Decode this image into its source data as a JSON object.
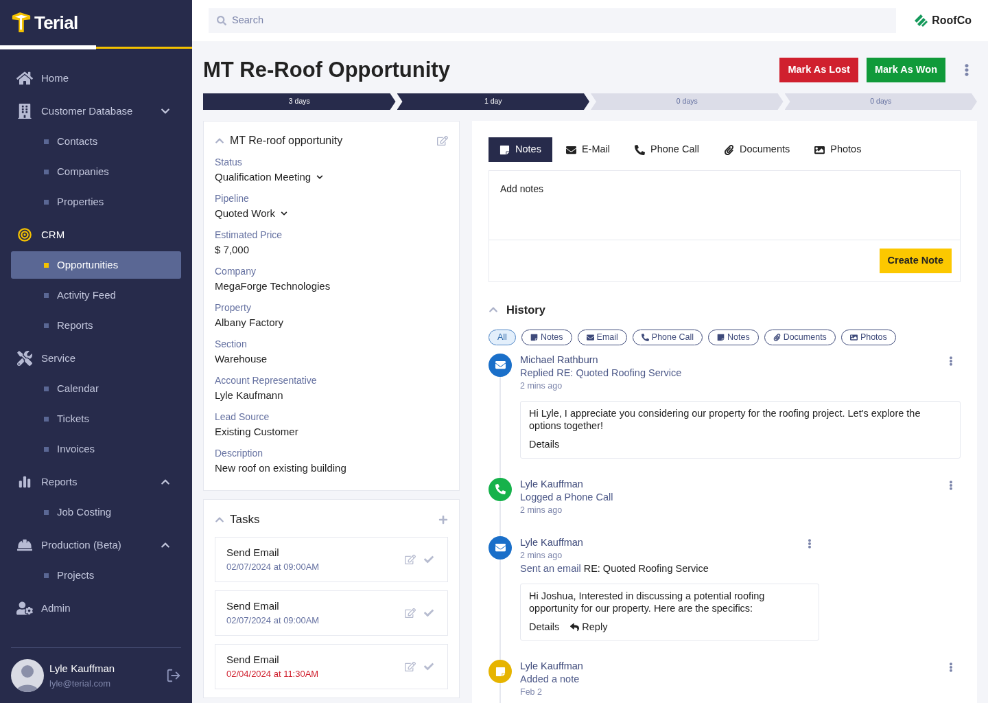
{
  "sidebar": {
    "brand": "Terial",
    "sections": [
      {
        "label": "Home",
        "selected": false
      },
      {
        "label": "Customer Database",
        "selected": false,
        "expanded": false,
        "children": [
          {
            "label": "Contacts",
            "selected": false
          },
          {
            "label": "Companies",
            "selected": false
          },
          {
            "label": "Properties",
            "selected": false
          }
        ]
      },
      {
        "label": "CRM",
        "selected": true,
        "children": [
          {
            "label": "Opportunities",
            "selected": true
          },
          {
            "label": "Activity Feed",
            "selected": false
          },
          {
            "label": "Reports",
            "selected": false
          }
        ]
      },
      {
        "label": "Service",
        "selected": false,
        "children": [
          {
            "label": "Calendar",
            "selected": false
          },
          {
            "label": "Tickets",
            "selected": false
          },
          {
            "label": "Invoices",
            "selected": false
          }
        ]
      },
      {
        "label": "Reports",
        "selected": false,
        "expanded": true,
        "children": [
          {
            "label": "Job Costing",
            "selected": false
          }
        ]
      },
      {
        "label": "Production (Beta)",
        "selected": false,
        "expanded": true,
        "children": [
          {
            "label": "Projects",
            "selected": false
          }
        ]
      },
      {
        "label": "Admin",
        "selected": false
      }
    ],
    "user": {
      "name": "Lyle Kauffman",
      "email": "lyle@terial.com"
    }
  },
  "search": {
    "placeholder": "Search"
  },
  "company": "RoofCo",
  "title": "MT Re-Roof Opportunity",
  "actions": [
    {
      "label": "Mark As Lost",
      "color": "#d0202e"
    },
    {
      "label": "Mark As Won",
      "color": "#109a3a"
    }
  ],
  "stages": [
    {
      "label": "3 days",
      "done": true
    },
    {
      "label": "1 day",
      "done": true
    },
    {
      "label": "0 days",
      "done": false
    },
    {
      "label": "0 days",
      "done": false
    }
  ],
  "details": {
    "title": "MT Re-roof opportunity",
    "fields": [
      {
        "label": "Status",
        "value": "Qualification Meeting",
        "kind": "dropdown"
      },
      {
        "label": "Pipeline",
        "value": "Quoted Work",
        "kind": "dropdown"
      },
      {
        "label": "Estimated Price",
        "value": "$ 7,000",
        "kind": "text"
      },
      {
        "label": "Company",
        "value": "MegaForge Technologies",
        "kind": "text"
      },
      {
        "label": "Property",
        "value": "Albany Factory",
        "kind": "text"
      },
      {
        "label": "Section",
        "value": "Warehouse",
        "kind": "text"
      },
      {
        "label": "Account Representative",
        "value": "Lyle Kaufmann",
        "kind": "text"
      },
      {
        "label": "Lead Source",
        "value": "Existing Customer",
        "kind": "text"
      },
      {
        "label": "Description",
        "value": "New roof on existing building",
        "kind": "text"
      }
    ]
  },
  "tasks": {
    "title": "Tasks",
    "items": [
      {
        "title": "Send Email",
        "due": "02/07/2024 at 09:00AM",
        "overdue": false
      },
      {
        "title": "Send Email",
        "due": "02/07/2024 at 09:00AM",
        "overdue": false
      },
      {
        "title": "Send Email",
        "due": "02/04/2024 at 11:30AM",
        "overdue": true
      }
    ]
  },
  "tabs": [
    {
      "label": "Notes",
      "selected": true
    },
    {
      "label": "E-Mail",
      "selected": false
    },
    {
      "label": "Phone Call",
      "selected": false
    },
    {
      "label": "Documents",
      "selected": false
    },
    {
      "label": "Photos",
      "selected": false
    }
  ],
  "notes": {
    "placeholder": "Add notes",
    "button": "Create Note"
  },
  "history": {
    "title": "History",
    "filters": [
      {
        "label": "All",
        "selected": true
      },
      {
        "label": "Notes",
        "selected": false
      },
      {
        "label": "Email",
        "selected": false
      },
      {
        "label": "Phone Call",
        "selected": false
      },
      {
        "label": "Notes",
        "selected": false
      },
      {
        "label": "Documents",
        "selected": false
      },
      {
        "label": "Photos",
        "selected": false
      }
    ],
    "entries": [
      {
        "kind": "email",
        "color": "#1a6fc9",
        "name": "Michael Rathburn",
        "action": "Replied RE: Quoted Roofing Service",
        "time": "2 mins ago",
        "body": "Hi Lyle, I appreciate you considering our property for the roofing project. Let's explore the options together!",
        "links": [
          "Details"
        ]
      },
      {
        "kind": "phone",
        "color": "#16b24b",
        "name": "Lyle Kauffman",
        "action": "Logged a Phone Call",
        "time": "2 mins ago"
      },
      {
        "kind": "email",
        "color": "#1a6fc9",
        "name": "Lyle Kauffman",
        "time": "2 mins ago",
        "action": "Sent an email",
        "subject": "RE: Quoted Roofing Service",
        "body": "Hi Joshua, Interested in discussing a potential roofing opportunity for our property. Here are the specifics:",
        "links": [
          "Details",
          "Reply"
        ]
      },
      {
        "kind": "note",
        "color": "#e6b400",
        "name": "Lyle Kauffman",
        "action": "Added a note",
        "time": "Feb 2"
      }
    ]
  }
}
